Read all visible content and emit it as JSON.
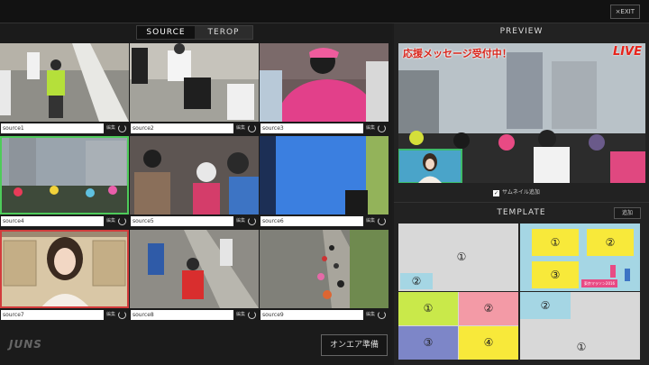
{
  "topbar": {
    "exit_label": "×EXIT"
  },
  "source_panel": {
    "tabs": [
      {
        "label": "SOURCE"
      },
      {
        "label": "TEROP"
      }
    ],
    "edit_label": "編集",
    "cells": [
      {
        "name": "source1"
      },
      {
        "name": "source2"
      },
      {
        "name": "source3"
      },
      {
        "name": "source4"
      },
      {
        "name": "source5"
      },
      {
        "name": "source6"
      },
      {
        "name": "source7"
      },
      {
        "name": "source8"
      },
      {
        "name": "source9"
      }
    ],
    "logo": "JUNS",
    "onair_label": "オンエア準備"
  },
  "preview": {
    "title": "PREVIEW",
    "banner": "応援メッセージ受付中！",
    "live_badge": "LIVE",
    "thumbnail_checkbox_label": "サムネイル追加",
    "thumbnail_checked": true
  },
  "template": {
    "title": "TEMPLATE",
    "add_label": "追加",
    "t1": {
      "big": "①",
      "small": "②"
    },
    "t2": {
      "a": "①",
      "b": "②",
      "c": "③",
      "banner": "東京マラソン2016"
    },
    "t3": {
      "a": "①",
      "b": "②",
      "c": "③",
      "d": "④"
    },
    "t4": {
      "big": "①",
      "small": "②"
    }
  },
  "colors": {
    "selected_green": "#4ecb5a",
    "selected_red": "#d23c3c",
    "yellow": "#f8e93a",
    "lime": "#c9e94a",
    "pink": "#f39aa6",
    "purple": "#7d86c8",
    "light_blue": "#a5d6e4"
  }
}
